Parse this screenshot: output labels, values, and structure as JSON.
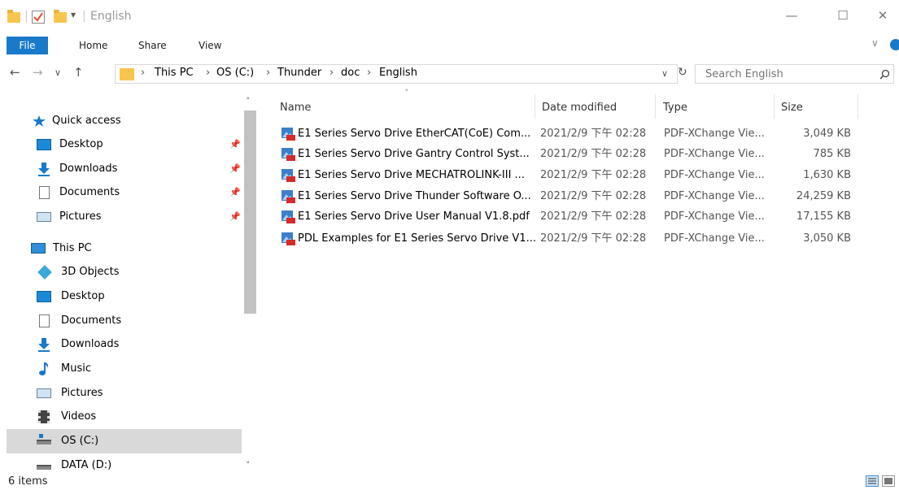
{
  "window": {
    "title": "English",
    "qa_arrow": "▾",
    "minimize": "—",
    "maximize": "☐",
    "close": "✕"
  },
  "ribbon": {
    "tabs": [
      "File",
      "Home",
      "Share",
      "View"
    ],
    "expand": "∨"
  },
  "address": {
    "back": "←",
    "forward": "→",
    "recent": "∨",
    "up": "↑",
    "crumbs": [
      "This PC",
      "OS (C:)",
      "Thunder",
      "doc",
      "English"
    ],
    "separator": "›",
    "dropdown": "∨",
    "refresh": "↻"
  },
  "search": {
    "placeholder": "Search English",
    "icon": "search-icon"
  },
  "nav": {
    "quick_access": "Quick access",
    "quick_items": [
      "Desktop",
      "Downloads",
      "Documents",
      "Pictures"
    ],
    "pin": "📌",
    "this_pc": "This PC",
    "pc_items": [
      "3D Objects",
      "Desktop",
      "Documents",
      "Downloads",
      "Music",
      "Pictures",
      "Videos",
      "OS (C:)",
      "DATA (D:)"
    ],
    "scroll_up": "˄",
    "scroll_down": "˅"
  },
  "columns": {
    "name": "Name",
    "date": "Date modified",
    "type": "Type",
    "size": "Size",
    "sort_indicator": "˄"
  },
  "files": [
    {
      "name": "E1 Series Servo Drive EtherCAT(CoE) Com...",
      "date": "2021/2/9 下午 02:28",
      "type": "PDF-XChange Vie...",
      "size": "3,049 KB"
    },
    {
      "name": "E1 Series Servo Drive Gantry Control Syst...",
      "date": "2021/2/9 下午 02:28",
      "type": "PDF-XChange Vie...",
      "size": "785 KB"
    },
    {
      "name": "E1 Series Servo Drive MECHATROLINK-III ...",
      "date": "2021/2/9 下午 02:28",
      "type": "PDF-XChange Vie...",
      "size": "1,630 KB"
    },
    {
      "name": "E1 Series Servo Drive Thunder Software O...",
      "date": "2021/2/9 下午 02:28",
      "type": "PDF-XChange Vie...",
      "size": "24,259 KB"
    },
    {
      "name": "E1 Series Servo Drive User Manual V1.8.pdf",
      "date": "2021/2/9 下午 02:28",
      "type": "PDF-XChange Vie...",
      "size": "17,155 KB"
    },
    {
      "name": "PDL Examples for E1 Series Servo Drive V1...",
      "date": "2021/2/9 下午 02:28",
      "type": "PDF-XChange Vie...",
      "size": "3,050 KB"
    }
  ],
  "status": {
    "count": "6 items"
  },
  "colors": {
    "accent": "#1979ca",
    "folder": "#f7c64e",
    "selection": "#d9d9d9"
  }
}
